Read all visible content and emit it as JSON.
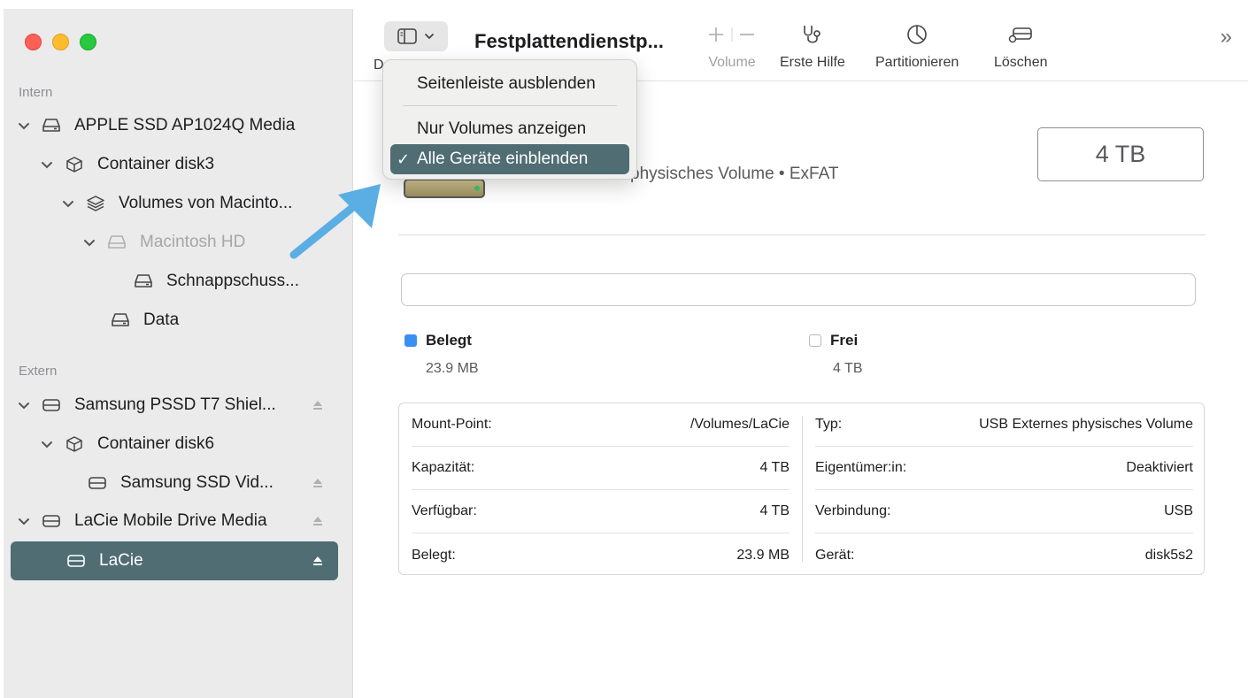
{
  "sidebar": {
    "sections": {
      "internal": "Intern",
      "external": "Extern"
    },
    "items": [
      {
        "label": "APPLE SSD AP1024Q Media",
        "icon": "internal-drive-icon"
      },
      {
        "label": "Container disk3",
        "icon": "container-cube-icon"
      },
      {
        "label": "Volumes von Macinto...",
        "icon": "volume-stack-icon"
      },
      {
        "label": "Macintosh HD",
        "icon": "internal-drive-icon"
      },
      {
        "label": "Schnappschuss...",
        "icon": "internal-drive-icon"
      },
      {
        "label": "Data",
        "icon": "internal-drive-icon"
      },
      {
        "label": "Samsung PSSD T7 Shiel...",
        "icon": "external-drive-icon"
      },
      {
        "label": "Container disk6",
        "icon": "container-cube-icon"
      },
      {
        "label": "Samsung SSD Vid...",
        "icon": "external-drive-icon"
      },
      {
        "label": "LaCie Mobile Drive Media",
        "icon": "external-drive-icon"
      },
      {
        "label": "LaCie",
        "icon": "external-drive-icon"
      }
    ]
  },
  "toolbar": {
    "title": "Festplattendienstp...",
    "partial_label": "D",
    "buttons": [
      {
        "label": "Volume",
        "icon": "plus-minus-icon",
        "enabled": false
      },
      {
        "label": "Erste Hilfe",
        "icon": "stethoscope-icon",
        "enabled": true
      },
      {
        "label": "Partitionieren",
        "icon": "partition-pie-icon",
        "enabled": true
      },
      {
        "label": "Löschen",
        "icon": "erase-drive-icon",
        "enabled": true
      }
    ],
    "more": "»"
  },
  "menu": {
    "items": [
      {
        "label": "Seitenleiste ausblenden",
        "checked": false
      },
      {
        "label": "Nur Volumes anzeigen",
        "checked": false
      },
      {
        "label": "Alle Geräte einblenden",
        "checked": true
      }
    ],
    "check_glyph": "✓"
  },
  "volume": {
    "subtitle": "physisches Volume • ExFAT",
    "capacity": "4 TB",
    "usage": {
      "used_fraction": 0.0,
      "used_label": "Belegt",
      "used_value": "23.9 MB",
      "used_color": "#3b8ff2",
      "free_label": "Frei",
      "free_value": "4 TB"
    },
    "info_left": [
      {
        "key": "Mount-Point:",
        "value": "/Volumes/LaCie"
      },
      {
        "key": "Kapazität:",
        "value": "4 TB"
      },
      {
        "key": "Verfügbar:",
        "value": "4 TB"
      },
      {
        "key": "Belegt:",
        "value": "23.9 MB"
      }
    ],
    "info_right": [
      {
        "key": "Typ:",
        "value": "USB Externes physisches Volume"
      },
      {
        "key": "Eigentümer:in:",
        "value": "Deaktiviert"
      },
      {
        "key": "Verbindung:",
        "value": "USB"
      },
      {
        "key": "Gerät:",
        "value": "disk5s2"
      }
    ]
  },
  "colors": {
    "selection": "#4f6d73",
    "sidebar_bg": "#ebebeb",
    "annotation_arrow": "#5aaee3"
  }
}
